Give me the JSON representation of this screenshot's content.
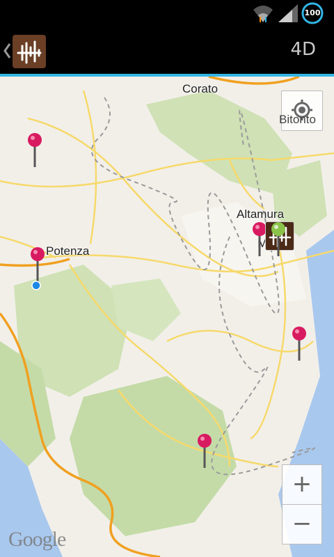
{
  "status_bar": {
    "battery_level": "100",
    "icons": [
      "wifi-icon",
      "signal-icon",
      "battery-icon"
    ]
  },
  "action_bar": {
    "title": "4D",
    "logo_icon": "app-logo-icon",
    "back_icon": "chevron-left-icon"
  },
  "map": {
    "cities": [
      "Corato",
      "Bitonto",
      "Altamura",
      "Matera",
      "Potenza"
    ],
    "attribution": "Google",
    "zoom_in_label": "+",
    "zoom_out_label": "−",
    "pins": [
      {
        "name": "pin-north-west",
        "color": "#d81b60"
      },
      {
        "name": "pin-potenza",
        "color": "#d81b60"
      },
      {
        "name": "pin-altamura",
        "color": "#d81b60"
      },
      {
        "name": "pin-matera-green",
        "color": "#8bc34a"
      },
      {
        "name": "pin-east",
        "color": "#d81b60"
      },
      {
        "name": "pin-south",
        "color": "#d81b60"
      }
    ],
    "accent_color": "#33b5e5"
  }
}
